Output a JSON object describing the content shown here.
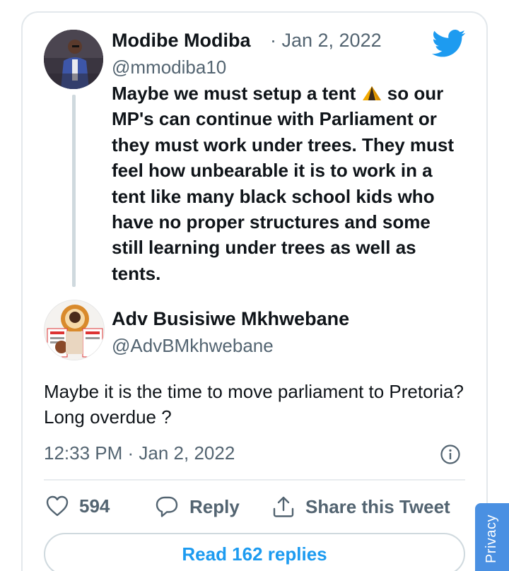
{
  "parent_tweet": {
    "author_name": "Modibe Modiba",
    "date": "· Jan 2, 2022",
    "handle": "@mmodiba10",
    "text_before_emoji": "Maybe we must setup a tent ",
    "emoji": "tent-emoji",
    "text_after_emoji": " so our MP's can continue with Parliament or they must work under trees. They must feel how unbearable it is to work in a tent like many black school kids who have no proper structures and some still learning under trees as well as tents."
  },
  "main_tweet": {
    "author_name": "Adv Busisiwe Mkhwebane",
    "handle": "@AdvBMkhwebane",
    "text": "Maybe it is the time to move parliament to Pretoria? Long overdue ?",
    "timestamp": "12:33 PM · Jan 2, 2022"
  },
  "actions": {
    "like_count": "594",
    "reply_label": "Reply",
    "share_label": "Share this Tweet"
  },
  "read_replies_label": "Read 162 replies",
  "privacy_label": "Privacy",
  "colors": {
    "accent": "#1d9bf0",
    "secondary_text": "#536471",
    "border": "#cfd9de",
    "privacy_tab": "#4a90e2"
  },
  "icons": [
    "twitter-bird-icon",
    "info-icon",
    "heart-icon",
    "reply-icon",
    "share-icon",
    "tent-emoji"
  ]
}
